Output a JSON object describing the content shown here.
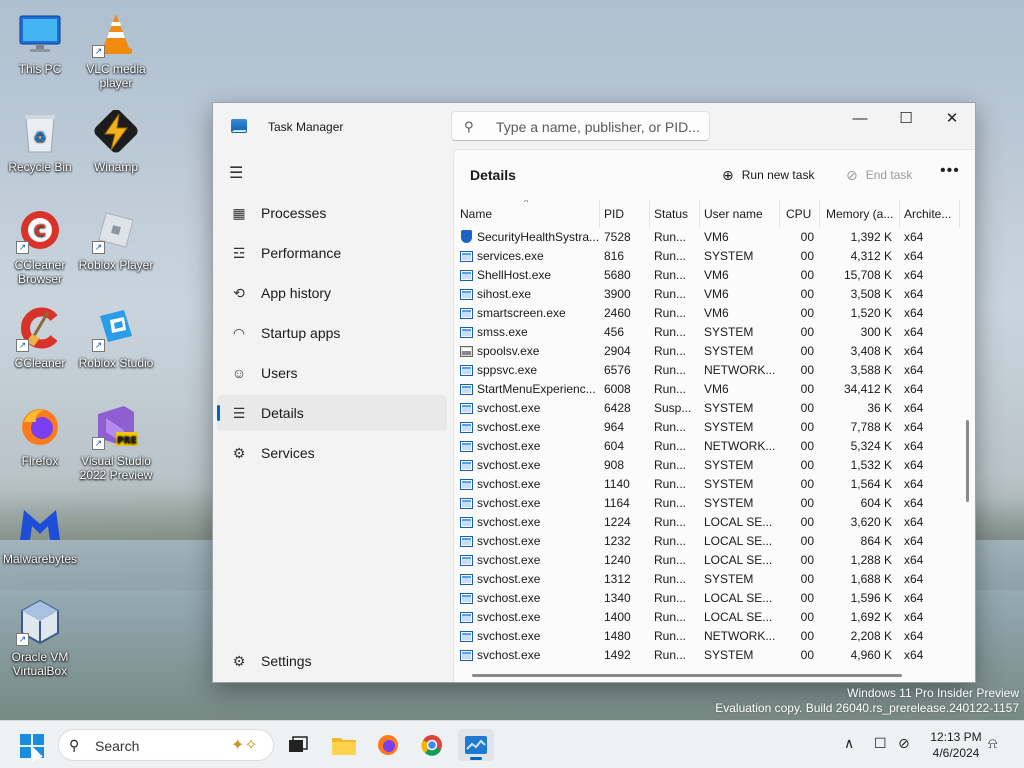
{
  "desktop": {
    "icons": [
      {
        "label": "This PC",
        "icon": "monitor-icon"
      },
      {
        "label": "VLC media player",
        "icon": "vlc-cone-icon"
      },
      {
        "label": "Recycle Bin",
        "icon": "recycle-bin-icon"
      },
      {
        "label": "Winamp",
        "icon": "winamp-bolt-icon"
      },
      {
        "label": "CCleaner Browser",
        "icon": "ccleaner-browser-icon"
      },
      {
        "label": "Roblox Player",
        "icon": "roblox-icon"
      },
      {
        "label": "CCleaner",
        "icon": "ccleaner-icon"
      },
      {
        "label": "Roblox Studio",
        "icon": "roblox-studio-icon"
      },
      {
        "label": "Firefox",
        "icon": "firefox-icon"
      },
      {
        "label": "Visual Studio 2022 Preview",
        "icon": "visual-studio-icon",
        "badge": "PRE"
      },
      {
        "label": "Malwarebytes",
        "icon": "malwarebytes-icon"
      },
      {
        "label": "Oracle VM VirtualBox",
        "icon": "virtualbox-icon"
      }
    ]
  },
  "window": {
    "title": "Task Manager",
    "search_placeholder": "Type a name, publisher, or PID...",
    "controls": {
      "minimize": "—",
      "maximize": "☐",
      "close": "✕"
    }
  },
  "sidebar": {
    "items": [
      {
        "label": "Processes",
        "icon": "processes-grid-icon"
      },
      {
        "label": "Performance",
        "icon": "performance-chart-icon"
      },
      {
        "label": "App history",
        "icon": "history-clock-icon"
      },
      {
        "label": "Startup apps",
        "icon": "startup-gauge-icon"
      },
      {
        "label": "Users",
        "icon": "users-icon"
      },
      {
        "label": "Details",
        "icon": "details-list-icon"
      },
      {
        "label": "Services",
        "icon": "services-puzzle-icon"
      }
    ],
    "settings_label": "Settings",
    "active": "Details"
  },
  "main": {
    "title": "Details",
    "run_new_task": "Run new task",
    "end_task": "End task",
    "more": "•••",
    "columns": [
      "Name",
      "PID",
      "Status",
      "User name",
      "CPU",
      "Memory (a...",
      "Archite..."
    ],
    "rows": [
      {
        "name": "SecurityHealthSystra...",
        "pid": "7528",
        "status": "Run...",
        "user": "VM6",
        "cpu": "00",
        "mem": "1,392 K",
        "arch": "x64",
        "icon": "shield"
      },
      {
        "name": "services.exe",
        "pid": "816",
        "status": "Run...",
        "user": "SYSTEM",
        "cpu": "00",
        "mem": "4,312 K",
        "arch": "x64",
        "icon": "app"
      },
      {
        "name": "ShellHost.exe",
        "pid": "5680",
        "status": "Run...",
        "user": "VM6",
        "cpu": "00",
        "mem": "15,708 K",
        "arch": "x64",
        "icon": "app"
      },
      {
        "name": "sihost.exe",
        "pid": "3900",
        "status": "Run...",
        "user": "VM6",
        "cpu": "00",
        "mem": "3,508 K",
        "arch": "x64",
        "icon": "app"
      },
      {
        "name": "smartscreen.exe",
        "pid": "2460",
        "status": "Run...",
        "user": "VM6",
        "cpu": "00",
        "mem": "1,520 K",
        "arch": "x64",
        "icon": "app"
      },
      {
        "name": "smss.exe",
        "pid": "456",
        "status": "Run...",
        "user": "SYSTEM",
        "cpu": "00",
        "mem": "300 K",
        "arch": "x64",
        "icon": "app"
      },
      {
        "name": "spoolsv.exe",
        "pid": "2904",
        "status": "Run...",
        "user": "SYSTEM",
        "cpu": "00",
        "mem": "3,408 K",
        "arch": "x64",
        "icon": "printer"
      },
      {
        "name": "sppsvc.exe",
        "pid": "6576",
        "status": "Run...",
        "user": "NETWORK...",
        "cpu": "00",
        "mem": "3,588 K",
        "arch": "x64",
        "icon": "app"
      },
      {
        "name": "StartMenuExperienc...",
        "pid": "6008",
        "status": "Run...",
        "user": "VM6",
        "cpu": "00",
        "mem": "34,412 K",
        "arch": "x64",
        "icon": "app"
      },
      {
        "name": "svchost.exe",
        "pid": "6428",
        "status": "Susp...",
        "user": "SYSTEM",
        "cpu": "00",
        "mem": "36 K",
        "arch": "x64",
        "icon": "app"
      },
      {
        "name": "svchost.exe",
        "pid": "964",
        "status": "Run...",
        "user": "SYSTEM",
        "cpu": "00",
        "mem": "7,788 K",
        "arch": "x64",
        "icon": "app"
      },
      {
        "name": "svchost.exe",
        "pid": "604",
        "status": "Run...",
        "user": "NETWORK...",
        "cpu": "00",
        "mem": "5,324 K",
        "arch": "x64",
        "icon": "app"
      },
      {
        "name": "svchost.exe",
        "pid": "908",
        "status": "Run...",
        "user": "SYSTEM",
        "cpu": "00",
        "mem": "1,532 K",
        "arch": "x64",
        "icon": "app"
      },
      {
        "name": "svchost.exe",
        "pid": "1140",
        "status": "Run...",
        "user": "SYSTEM",
        "cpu": "00",
        "mem": "1,564 K",
        "arch": "x64",
        "icon": "app"
      },
      {
        "name": "svchost.exe",
        "pid": "1164",
        "status": "Run...",
        "user": "SYSTEM",
        "cpu": "00",
        "mem": "604 K",
        "arch": "x64",
        "icon": "app"
      },
      {
        "name": "svchost.exe",
        "pid": "1224",
        "status": "Run...",
        "user": "LOCAL SE...",
        "cpu": "00",
        "mem": "3,620 K",
        "arch": "x64",
        "icon": "app"
      },
      {
        "name": "svchost.exe",
        "pid": "1232",
        "status": "Run...",
        "user": "LOCAL SE...",
        "cpu": "00",
        "mem": "864 K",
        "arch": "x64",
        "icon": "app"
      },
      {
        "name": "svchost.exe",
        "pid": "1240",
        "status": "Run...",
        "user": "LOCAL SE...",
        "cpu": "00",
        "mem": "1,288 K",
        "arch": "x64",
        "icon": "app"
      },
      {
        "name": "svchost.exe",
        "pid": "1312",
        "status": "Run...",
        "user": "SYSTEM",
        "cpu": "00",
        "mem": "1,688 K",
        "arch": "x64",
        "icon": "app"
      },
      {
        "name": "svchost.exe",
        "pid": "1340",
        "status": "Run...",
        "user": "LOCAL SE...",
        "cpu": "00",
        "mem": "1,596 K",
        "arch": "x64",
        "icon": "app"
      },
      {
        "name": "svchost.exe",
        "pid": "1400",
        "status": "Run...",
        "user": "LOCAL SE...",
        "cpu": "00",
        "mem": "1,692 K",
        "arch": "x64",
        "icon": "app"
      },
      {
        "name": "svchost.exe",
        "pid": "1480",
        "status": "Run...",
        "user": "NETWORK...",
        "cpu": "00",
        "mem": "2,208 K",
        "arch": "x64",
        "icon": "app"
      },
      {
        "name": "svchost.exe",
        "pid": "1492",
        "status": "Run...",
        "user": "SYSTEM",
        "cpu": "00",
        "mem": "4,960 K",
        "arch": "x64",
        "icon": "app"
      }
    ]
  },
  "watermark": {
    "line1": "Windows 11 Pro Insider Preview",
    "line2": "Evaluation copy. Build 26040.rs_prerelease.240122-1157"
  },
  "taskbar": {
    "search_label": "Search",
    "apps": [
      "task-view-icon",
      "file-explorer-icon",
      "firefox-icon",
      "chrome-icon",
      "task-manager-icon"
    ],
    "time": "12:13 PM",
    "date": "4/6/2024"
  },
  "colors": {
    "accent": "#0067c0",
    "window_bg": "#f3f3f3",
    "panel_bg": "#fbfbfb",
    "taskbar_bg": "#eef1f4"
  }
}
